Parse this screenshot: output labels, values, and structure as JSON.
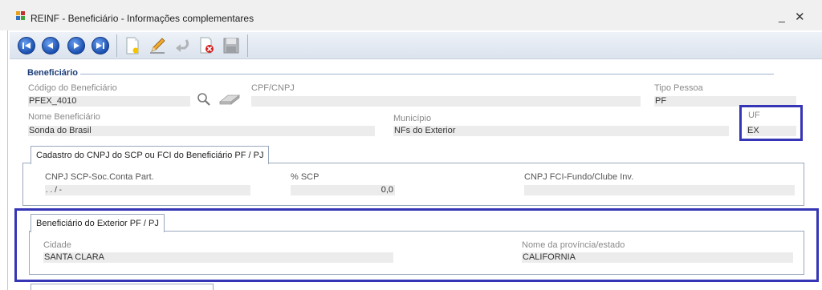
{
  "window": {
    "title": "REINF - Beneficiário - Informações complementares",
    "minimize_glyph": "_",
    "close_glyph": "✕"
  },
  "toolbar": {
    "buttons": [
      {
        "name": "first-record",
        "icon": "first-icon"
      },
      {
        "name": "previous-record",
        "icon": "previous-icon"
      },
      {
        "name": "next-record",
        "icon": "next-icon"
      },
      {
        "name": "last-record",
        "icon": "last-icon"
      },
      {
        "name": "new-record",
        "icon": "new-document-icon"
      },
      {
        "name": "edit-record",
        "icon": "pencil-icon"
      },
      {
        "name": "undo",
        "icon": "undo-icon"
      },
      {
        "name": "delete-record",
        "icon": "delete-icon"
      },
      {
        "name": "save",
        "icon": "save-icon"
      }
    ]
  },
  "beneficiario": {
    "section_title": "Beneficiário",
    "codigo_label": "Código do Beneficiário",
    "codigo_value": "PFEX_4010",
    "cpf_label": "CPF/CNPJ",
    "cpf_value": "",
    "tipo_label": "Tipo Pessoa",
    "tipo_value": "PF",
    "nome_label": "Nome Beneficiário",
    "nome_value": "Sonda do Brasil",
    "municipio_label": "Município",
    "municipio_value": "NFs do Exterior",
    "uf_label": "UF",
    "uf_value": "EX"
  },
  "cadastro_tab": {
    "label": "Cadastro do CNPJ do SCP ou FCI do Beneficiário PF / PJ",
    "cnpj_scp_label": "CNPJ SCP-Soc.Conta Part.",
    "cnpj_scp_value": "  .  .  /    -",
    "scp_pct_label": "% SCP",
    "scp_pct_value": "0,0",
    "cnpj_fci_label": "CNPJ FCI-Fundo/Clube Inv.",
    "cnpj_fci_value": ""
  },
  "exterior_tab": {
    "label": "Beneficiário do Exterior PF / PJ",
    "cidade_label": "Cidade",
    "cidade_value": "SANTA CLARA",
    "provincia_label": "Nome da província/estado",
    "provincia_value": "CALIFORNIA"
  },
  "colors": {
    "highlight": "#3535b5",
    "section_title": "#1e3f7a",
    "field_bg": "#ececec",
    "label": "#8a8a8a"
  }
}
